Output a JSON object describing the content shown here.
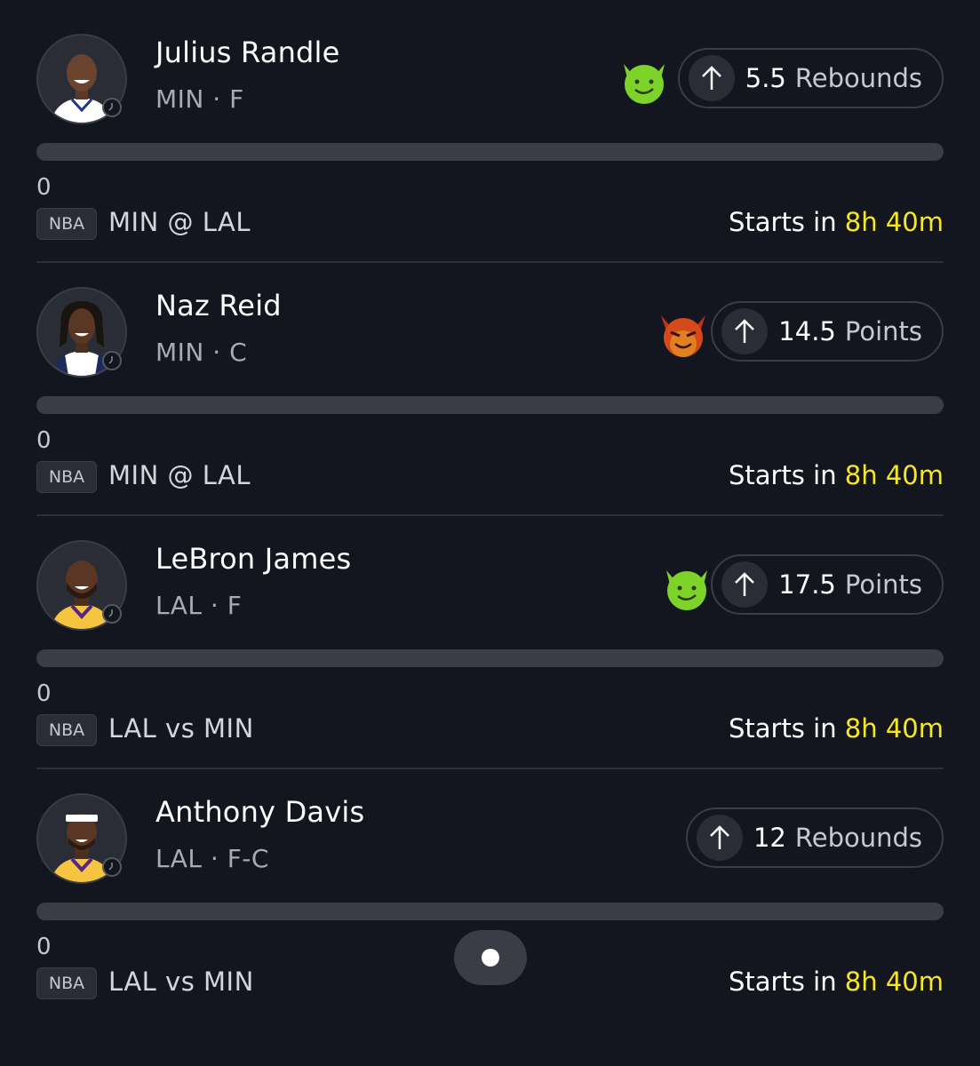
{
  "colors": {
    "background": "#14161f",
    "highlight": "#f5e626",
    "track": "#3a3c46",
    "goblin": "#7ed32b",
    "demon": "#d44a1a"
  },
  "cards": [
    {
      "name": "Julius Randle",
      "meta": "MIN · F",
      "emoji": "goblin-icon",
      "line_value": "5.5",
      "line_stat": "Rebounds",
      "direction": "up-arrow-icon",
      "progress": 0,
      "progress_count": "0",
      "league": "NBA",
      "matchup": "MIN @ LAL",
      "starts_prefix": "Starts in",
      "starts_time": "8h 40m",
      "jersey_color": "#ffffff"
    },
    {
      "name": "Naz Reid",
      "meta": "MIN · C",
      "emoji": "demon-icon",
      "line_value": "14.5",
      "line_stat": "Points",
      "direction": "up-arrow-icon",
      "progress": 0,
      "progress_count": "0",
      "league": "NBA",
      "matchup": "MIN @ LAL",
      "starts_prefix": "Starts in",
      "starts_time": "8h 40m",
      "jersey_color": "#ffffff"
    },
    {
      "name": "LeBron James",
      "meta": "LAL · F",
      "emoji": "goblin-icon",
      "line_value": "17.5",
      "line_stat": "Points",
      "direction": "up-arrow-icon",
      "progress": 0,
      "progress_count": "0",
      "league": "NBA",
      "matchup": "LAL vs MIN",
      "starts_prefix": "Starts in",
      "starts_time": "8h 40m",
      "jersey_color": "#f5c542"
    },
    {
      "name": "Anthony Davis",
      "meta": "LAL · F-C",
      "emoji": "",
      "line_value": "12",
      "line_stat": "Rebounds",
      "direction": "up-arrow-icon",
      "progress": 0,
      "progress_count": "0",
      "league": "NBA",
      "matchup": "LAL vs MIN",
      "starts_prefix": "Starts in",
      "starts_time": "8h 40m",
      "jersey_color": "#f5c542"
    }
  ]
}
